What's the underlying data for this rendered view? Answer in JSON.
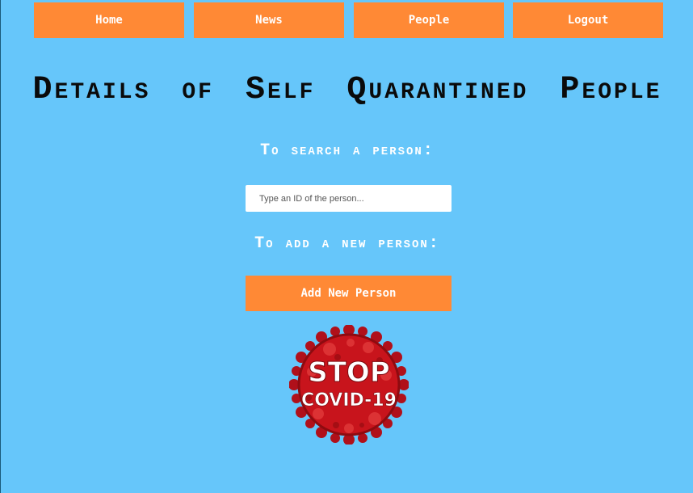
{
  "nav": {
    "items": [
      {
        "label": "Home"
      },
      {
        "label": "News"
      },
      {
        "label": "People"
      },
      {
        "label": "Logout"
      }
    ]
  },
  "main": {
    "title": "Details of Self Quarantined People",
    "search_label": "To search a person:",
    "search_placeholder": "Type an ID of the person...",
    "add_label": "To add a new person:",
    "add_button": "Add New Person"
  },
  "logo": {
    "line1": "STOP",
    "line2": "COVID-19",
    "colors": {
      "virus": "#c8141c",
      "virus_dark": "#8e0b10",
      "text": "#ffffff"
    }
  },
  "theme": {
    "background": "#66c6fa",
    "accent": "#ff8935"
  }
}
